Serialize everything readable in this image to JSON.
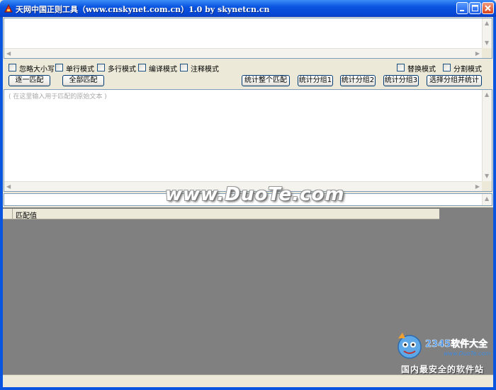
{
  "window": {
    "title": "天网中国正则工具（www.cnskynet.com.cn）1.0 by skynetcn.cn"
  },
  "options_left": [
    {
      "label": "忽略大小写",
      "checked": false
    },
    {
      "label": "单行模式",
      "checked": false
    },
    {
      "label": "多行模式",
      "checked": false
    },
    {
      "label": "编译模式",
      "checked": false
    },
    {
      "label": "注释模式",
      "checked": false
    }
  ],
  "options_right": [
    {
      "label": "替换模式",
      "checked": false
    },
    {
      "label": "分割模式",
      "checked": false
    }
  ],
  "buttons": {
    "match_one": "逐一匹配",
    "match_all": "全部匹配",
    "count_whole": "统计整个匹配",
    "count_group1": "统计分组1",
    "count_group2": "统计分组2",
    "count_group3": "统计分组3",
    "select_group": "选择分组并统计"
  },
  "source_input": {
    "placeholder": "( 在这里输入用于匹配的原始文本 )"
  },
  "results": {
    "column_header": "匹配值"
  },
  "watermark": {
    "text": "www.DuoTe.com",
    "logo_text": "2345软件大全",
    "logo_url": "www.DuoTe.com",
    "caption": "国内最安全的软件站"
  }
}
